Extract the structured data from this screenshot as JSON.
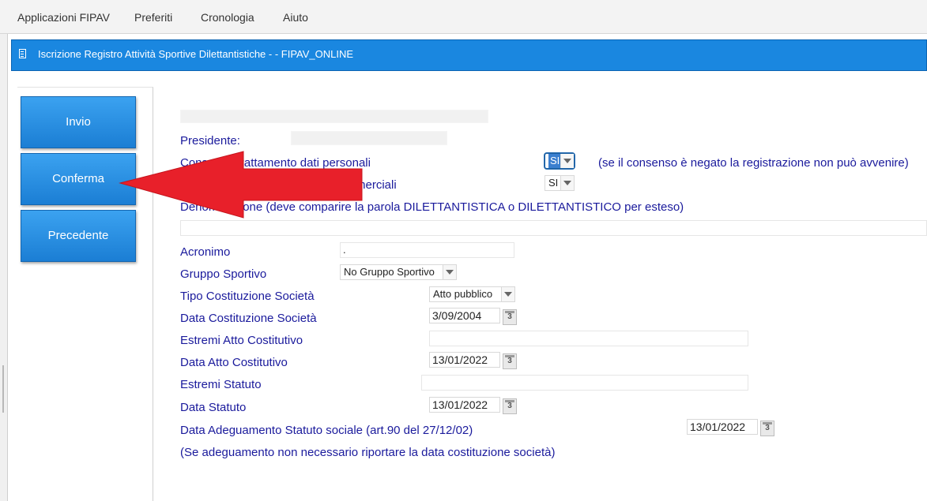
{
  "menubar": {
    "items": [
      "Applicazioni FIPAV",
      "Preferiti",
      "Cronologia",
      "Aiuto"
    ]
  },
  "window": {
    "title": "Iscrizione Registro Attività Sportive Dilettantistiche - - FIPAV_ONLINE"
  },
  "sidebar": {
    "buttons": {
      "invio": "Invio",
      "conferma": "Conferma",
      "precedente": "Precedente"
    }
  },
  "form": {
    "presidente_label": "Presidente:",
    "consenso_personali_label": "Consenso trattamento dati personali",
    "consenso_personali_value": "SI",
    "consenso_personali_hint": "(se il consenso è negato la registrazione non può avvenire)",
    "consenso_commerciali_label": "merciali",
    "consenso_commerciali_value": "SI",
    "denominazione_label": "Denominazione (deve comparire la parola DILETTANTISTICA o DILETTANTISTICO per esteso)",
    "acronimo_label": "Acronimo",
    "acronimo_value": ".",
    "gruppo_sportivo_label": "Gruppo Sportivo",
    "gruppo_sportivo_value": "No Gruppo Sportivo",
    "tipo_costituzione_label": "Tipo Costituzione Società",
    "tipo_costituzione_value": "Atto pubblico",
    "data_costituzione_label": "Data Costituzione Società",
    "data_costituzione_value": "3/09/2004",
    "estremi_atto_label": "Estremi Atto Costitutivo",
    "data_atto_label": "Data Atto Costitutivo",
    "data_atto_value": "13/01/2022",
    "estremi_statuto_label": "Estremi Statuto",
    "data_statuto_label": "Data Statuto",
    "data_statuto_value": "13/01/2022",
    "data_adeguamento_label": "Data Adeguamento Statuto sociale (art.90 del 27/12/02)",
    "data_adeguamento_value": "13/01/2022",
    "adeguamento_note": "(Se adeguamento non necessario riportare la data costituzione società)"
  },
  "icons": {
    "calendar_text": "3"
  },
  "colors": {
    "accent": "#1a87e0",
    "label_blue": "#1a1a9c",
    "arrow_red": "#e8202a"
  }
}
